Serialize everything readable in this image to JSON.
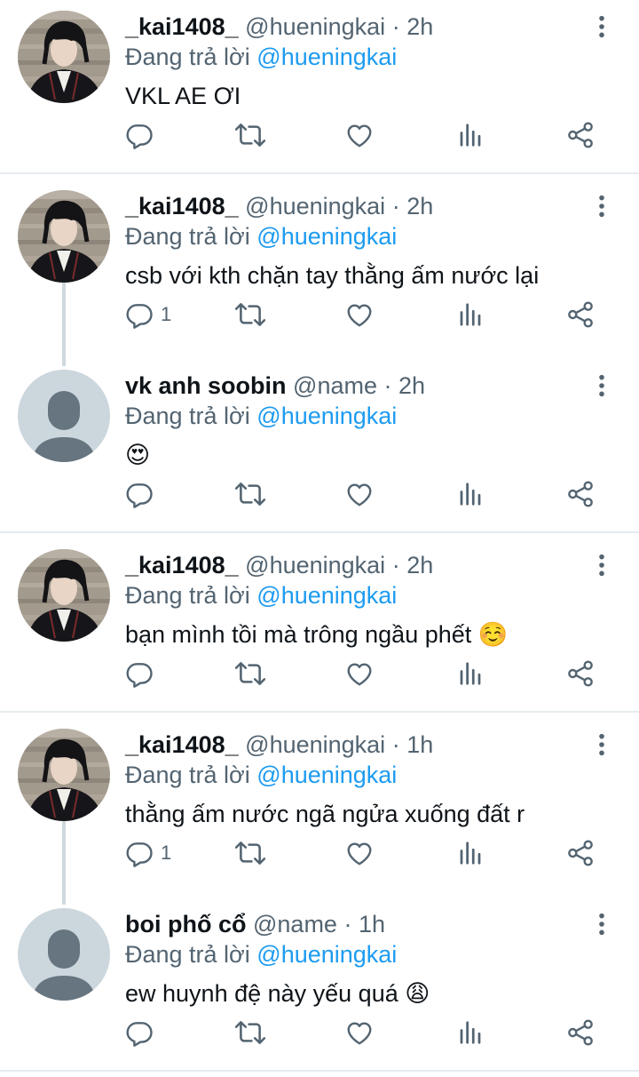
{
  "colors": {
    "mention": "#1d9bf0",
    "secondary": "#536471",
    "divider": "#e6ecf0",
    "thread_line": "#cfd9de"
  },
  "tweets": [
    {
      "display_name": "_kai1408_",
      "handle": "@hueningkai",
      "time": "2h",
      "reply_prefix": "Đang trả lời",
      "reply_to": "@hueningkai",
      "text": "VKL AE ƠI",
      "emoji": "",
      "reply_count": "",
      "avatar": "photo"
    },
    {
      "display_name": "_kai1408_",
      "handle": "@hueningkai",
      "time": "2h",
      "reply_prefix": "Đang trả lời",
      "reply_to": "@hueningkai",
      "text": "csb với kth chặn tay thằng ấm nước lại",
      "emoji": "",
      "reply_count": "1",
      "avatar": "photo"
    },
    {
      "display_name": "vk anh soobin",
      "handle": "@name",
      "time": "2h",
      "reply_prefix": "Đang trả lời",
      "reply_to": "@hueningkai",
      "text": "",
      "emoji": "😍",
      "reply_count": "",
      "avatar": "default"
    },
    {
      "display_name": "_kai1408_",
      "handle": "@hueningkai",
      "time": "2h",
      "reply_prefix": "Đang trả lời",
      "reply_to": "@hueningkai",
      "text": "bạn mình tồi mà trông ngầu phết",
      "emoji": "☺️",
      "reply_count": "",
      "avatar": "photo"
    },
    {
      "display_name": "_kai1408_",
      "handle": "@hueningkai",
      "time": "1h",
      "reply_prefix": "Đang trả lời",
      "reply_to": "@hueningkai",
      "text": "thằng ấm nước ngã ngửa xuống đất r",
      "emoji": "",
      "reply_count": "1",
      "avatar": "photo"
    },
    {
      "display_name": "boi phố cổ",
      "handle": "@name",
      "time": "1h",
      "reply_prefix": "Đang trả lời",
      "reply_to": "@hueningkai",
      "text": "ew huynh đệ này yếu quá",
      "emoji": "😩",
      "reply_count": "",
      "avatar": "default"
    }
  ]
}
